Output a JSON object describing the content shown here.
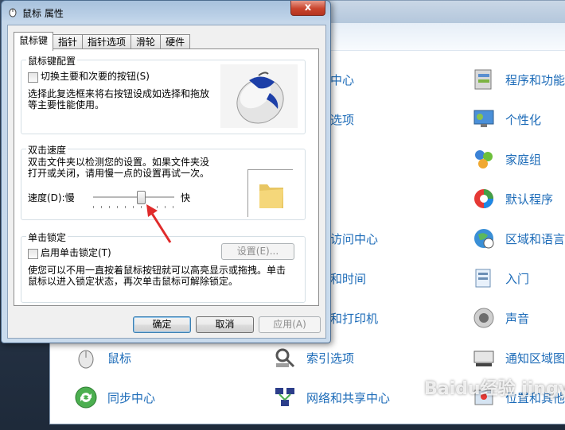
{
  "dialog": {
    "title": "鼠标 属性",
    "close_label": "x",
    "tabs": [
      {
        "label": "鼠标键",
        "active": true
      },
      {
        "label": "指针"
      },
      {
        "label": "指针选项"
      },
      {
        "label": "滑轮"
      },
      {
        "label": "硬件"
      }
    ],
    "button_config": {
      "group_title": "鼠标键配置",
      "switch_checkbox_label": "切换主要和次要的按钮(S)",
      "switch_checked": false,
      "description_line1": "选择此复选框来将右按钮设成如选择和拖放",
      "description_line2": "等主要性能使用。"
    },
    "double_click": {
      "group_title": "双击速度",
      "description_line1": "双击文件夹以检测您的设置。如果文件夹没",
      "description_line2": "打开或关闭，请用慢一点的设置再试一次。",
      "speed_label": "速度(D):慢",
      "fast_label": "快",
      "slider_value_fraction": 0.6
    },
    "click_lock": {
      "group_title": "单击锁定",
      "checkbox_label": "启用单击锁定(T)",
      "checked": false,
      "settings_button": "设置(E)...",
      "description_line1": "使您可以不用一直按着鼠标按钮就可以高亮显示或拖拽。单击",
      "description_line2": "鼠标以进入锁定状态，再次单击鼠标可解除锁定。"
    },
    "buttons": {
      "ok": "确定",
      "cancel": "取消",
      "apply": "应用(A)"
    }
  },
  "control_panel": {
    "items_col1_partial": [
      "中心",
      "选项",
      "访问中心",
      "和时间",
      "和打印机"
    ],
    "items_col2": [
      "程序和功能",
      "个性化",
      "家庭组",
      "默认程序",
      "区域和语言",
      "入门",
      "声音",
      "通知区域图"
    ],
    "bottom_items": [
      "鼠标",
      "索引选项",
      "同步中心",
      "网络和共享中心",
      "位置和其他"
    ]
  },
  "watermark": "Baidu经验 jingyan.baidu.com",
  "colors": {
    "link_blue": "#1c6bb8",
    "arrow_red": "#e02b2b",
    "close_red": "#c9442d"
  }
}
